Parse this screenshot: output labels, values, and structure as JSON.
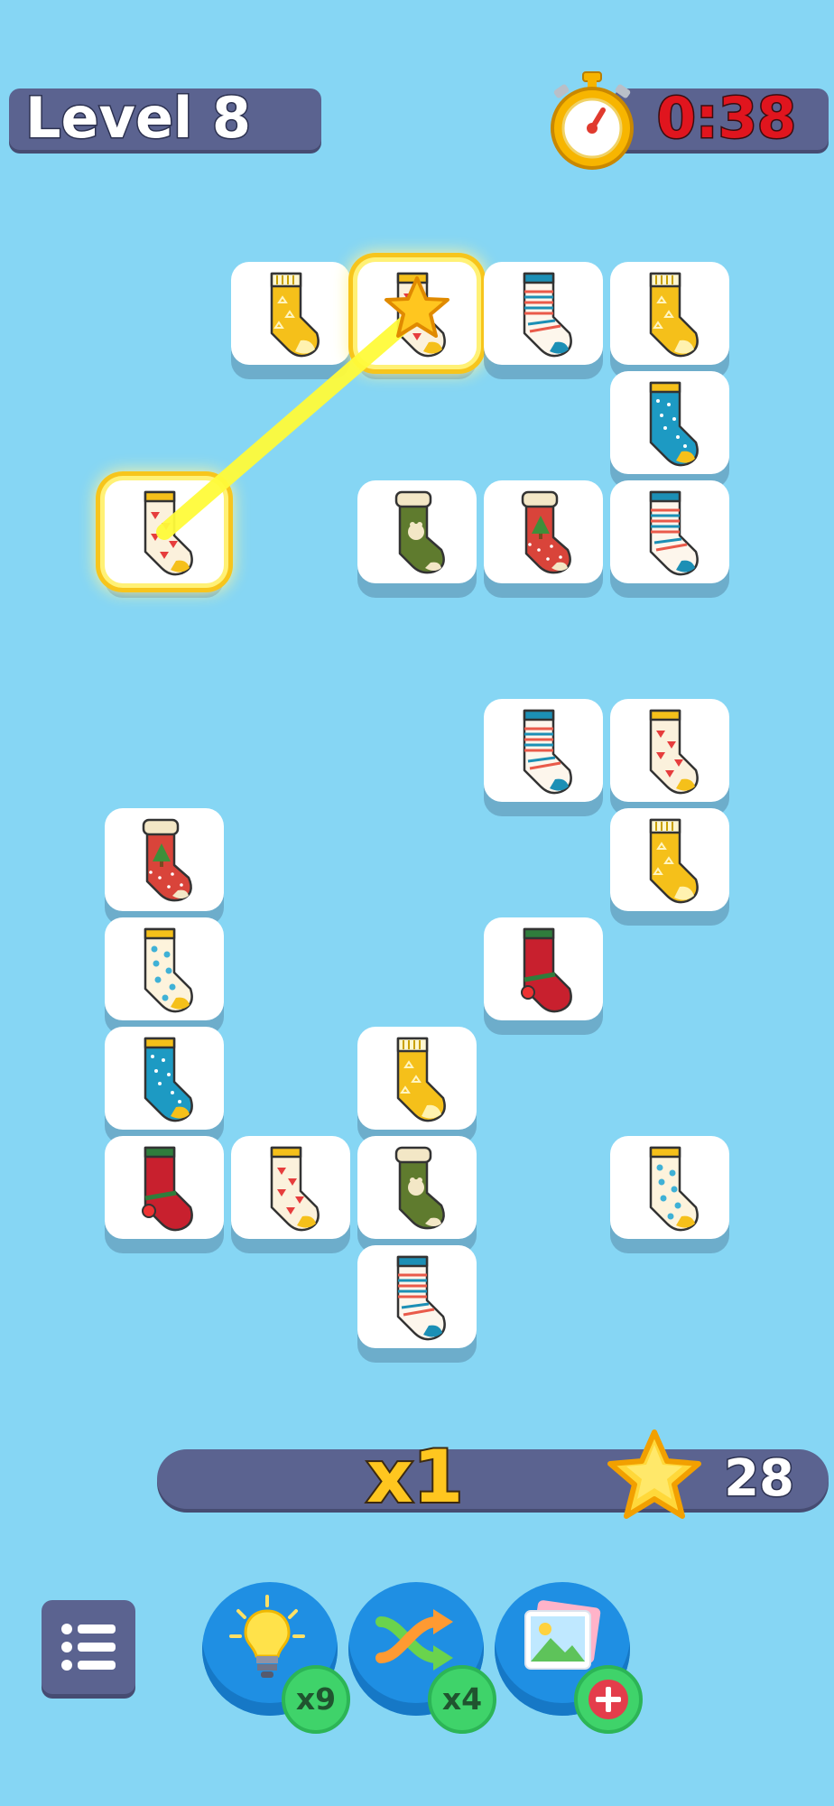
{
  "header": {
    "level_label": "Level 8",
    "timer": "0:38"
  },
  "colors": {
    "background": "#86d6f4",
    "panel": "#5b6390",
    "timer_red": "#e0151e",
    "gold": "#ffc61f",
    "selection_glow": "#f7c51c"
  },
  "board": {
    "tiles": [
      {
        "name": "tile-yellow-sock-1",
        "sock": "yellow"
      },
      {
        "name": "tile-cream-watermelon-sock-selected",
        "sock": "watermelon",
        "selected": true
      },
      {
        "name": "tile-striped-sock-1",
        "sock": "striped"
      },
      {
        "name": "tile-yellow-sock-2",
        "sock": "yellow"
      },
      {
        "name": "tile-teal-dotted-sock-1",
        "sock": "teal"
      },
      {
        "name": "tile-cream-watermelon-sock-selected-2",
        "sock": "watermelon",
        "selected": true
      },
      {
        "name": "tile-green-bear-stocking-1",
        "sock": "greenstock"
      },
      {
        "name": "tile-red-tree-stocking-1",
        "sock": "redstock"
      },
      {
        "name": "tile-striped-sock-2",
        "sock": "striped"
      },
      {
        "name": "tile-striped-sock-3",
        "sock": "striped"
      },
      {
        "name": "tile-watermelon-sock-2",
        "sock": "watermelon"
      },
      {
        "name": "tile-red-tree-stocking-2",
        "sock": "redstock"
      },
      {
        "name": "tile-yellow-sock-3",
        "sock": "yellow"
      },
      {
        "name": "tile-cream-polka-sock-1",
        "sock": "cream"
      },
      {
        "name": "tile-red-christmas-sock-1",
        "sock": "red"
      },
      {
        "name": "tile-teal-dotted-sock-2",
        "sock": "teal"
      },
      {
        "name": "tile-yellow-sock-4",
        "sock": "yellow"
      },
      {
        "name": "tile-red-christmas-sock-2",
        "sock": "red"
      },
      {
        "name": "tile-watermelon-sock-3",
        "sock": "watermelon"
      },
      {
        "name": "tile-green-bear-stocking-2",
        "sock": "greenstock"
      },
      {
        "name": "tile-cream-polka-sock-2",
        "sock": "cream"
      },
      {
        "name": "tile-striped-sock-4",
        "sock": "striped"
      }
    ]
  },
  "score_bar": {
    "multiplier": "x1",
    "score": "28"
  },
  "powerups": [
    {
      "name": "hint-lightbulb",
      "icon": "lightbulb-icon",
      "count": "x9"
    },
    {
      "name": "shuffle",
      "icon": "shuffle-icon",
      "count": "x4"
    },
    {
      "name": "change-theme",
      "icon": "picture-icon",
      "count": "+"
    }
  ],
  "menu": {
    "icon": "list-menu-icon"
  }
}
